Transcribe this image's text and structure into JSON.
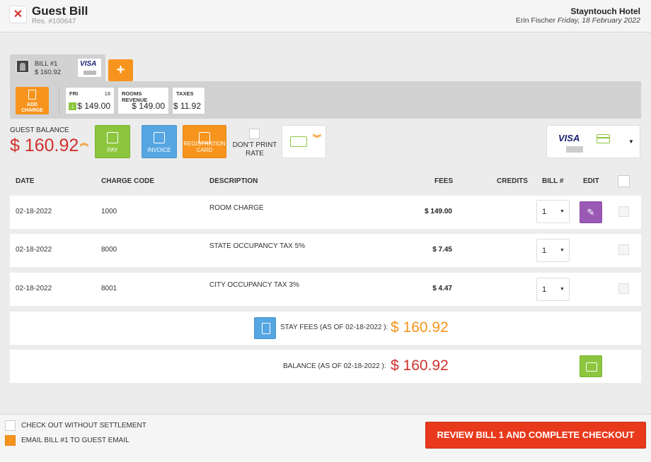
{
  "header": {
    "close_glyph": "✕",
    "title": "Guest Bill",
    "reservation": "Res. #100647",
    "hotel": "Stayntouch Hotel",
    "guest_name": "Erin Fischer",
    "date": "Friday, 18 February 2022"
  },
  "bill_tab": {
    "name": "BILL #1",
    "amount": "$ 160.92",
    "card_brand": "VISA",
    "add_label": "+"
  },
  "charge_band": {
    "add_charge_label": "ADD CHARGE",
    "day_name": "FRI",
    "day_number": "18",
    "day_amount": "$ 149.00",
    "rooms_revenue_label": "ROOMS REVENUE",
    "rooms_revenue_value": "$ 149.00",
    "taxes_label": "TAXES",
    "taxes_value": "$ 11.92"
  },
  "balance": {
    "label": "GUEST BALANCE",
    "value": "$ 160.92",
    "chevron": "︽"
  },
  "actions": {
    "pay": "PAY",
    "invoice": "INVOICE",
    "registration_card": "REGISTRATION CARD",
    "dont_print_rate": "DON'T PRINT RATE"
  },
  "payment_method": {
    "brand": "VISA",
    "dropdown": "▼"
  },
  "table": {
    "headers": {
      "date": "DATE",
      "charge_code": "CHARGE CODE",
      "description": "DESCRIPTION",
      "fees": "FEES",
      "credits": "CREDITS",
      "bill_no": "BILL #",
      "edit": "EDIT"
    },
    "rows": [
      {
        "date": "02-18-2022",
        "code": "1000",
        "description": "ROOM CHARGE",
        "fees": "$ 149.00",
        "bill": "1"
      },
      {
        "date": "02-18-2022",
        "code": "8000",
        "description": "STATE OCCUPANCY TAX 5%",
        "fees": "$ 7.45",
        "bill": "1"
      },
      {
        "date": "02-18-2022",
        "code": "8001",
        "description": "CITY OCCUPANCY TAX 3%",
        "fees": "$ 4.47",
        "bill": "1"
      }
    ],
    "select_arrow": "▼",
    "edit_glyph": "✎"
  },
  "summary": {
    "stay_fees_label": "STAY FEES (AS OF 02-18-2022 ):",
    "stay_fees_value": "$ 160.92",
    "balance_label": "BALANCE (AS OF 02-18-2022 ):",
    "balance_value": "$ 160.92"
  },
  "footer": {
    "checkout_without_settlement": "CHECK OUT WITHOUT SETTLEMENT",
    "email_bill": "EMAIL BILL #1 TO GUEST EMAIL",
    "review_button": "REVIEW BILL 1 AND COMPLETE CHECKOUT"
  },
  "colors": {
    "accent_orange": "#f7941d",
    "balance_red": "#d0312d",
    "pay_green": "#8cc63f",
    "invoice_blue": "#56a6e2",
    "edit_purple": "#9b59b6",
    "checkout_red": "#e8391c"
  }
}
